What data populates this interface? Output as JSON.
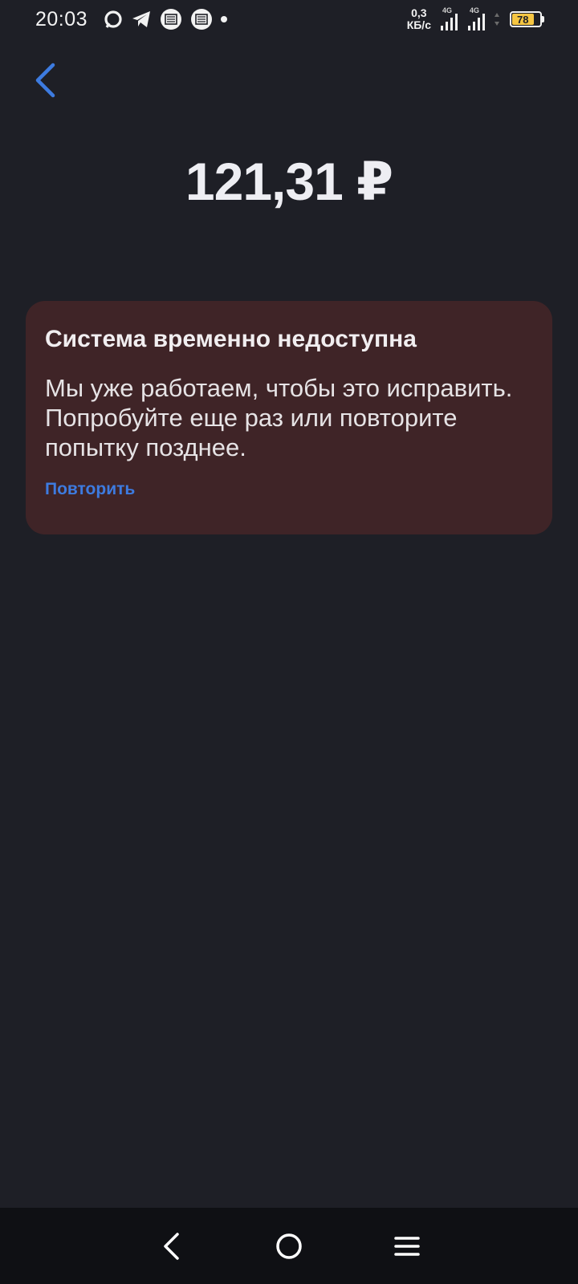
{
  "status_bar": {
    "time": "20:03",
    "net_speed_value": "0,3",
    "net_speed_unit": "КБ/с",
    "signal1_tag": "4G",
    "signal2_tag": "4G",
    "battery_level": "78",
    "battery_fraction": 0.78
  },
  "payment": {
    "amount": "121,31 ₽"
  },
  "error": {
    "title": "Система временно недоступна",
    "message": "Мы уже работаем, чтобы это исправить. Попробуйте еще раз или повторите попытку позднее.",
    "retry_label": "Повторить"
  },
  "colors": {
    "background": "#1e1f26",
    "card": "#3f2427",
    "accent": "#3d7be0",
    "battery": "#f5c542"
  },
  "icons": {
    "back": "chevron-left-icon",
    "nav_back": "nav-back-icon",
    "nav_home": "nav-home-icon",
    "nav_menu": "nav-menu-icon"
  }
}
